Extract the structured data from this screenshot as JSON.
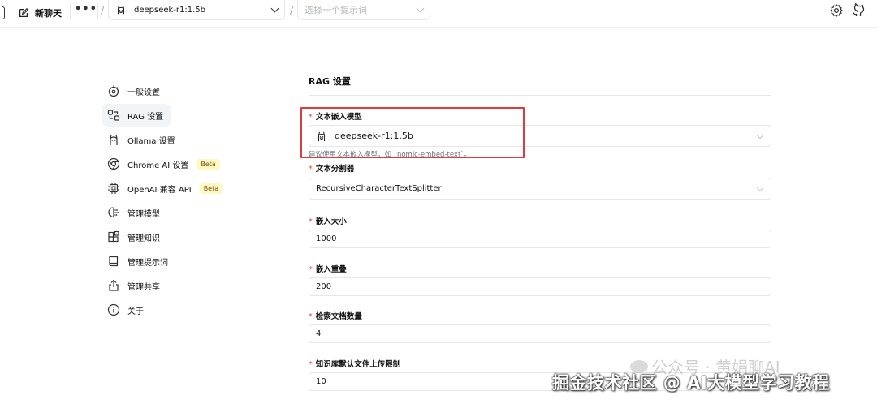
{
  "topbar": {
    "new_chat_label": "新聊天",
    "more_label": "•••",
    "slash1": "/",
    "model_select_value": "deepseek-r1:1.5b",
    "slash2": "/",
    "prompt_select_placeholder": "选择一个提示词",
    "icons": [
      "edit-icon",
      "more-icon",
      "ollama-icon",
      "chevron-down-icon",
      "settings-icon",
      "github-icon"
    ]
  },
  "sidebar": {
    "items": [
      {
        "label": "一般设置",
        "icon": "general-settings-icon",
        "active": false
      },
      {
        "label": "RAG 设置",
        "icon": "rag-icon",
        "active": true
      },
      {
        "label": "Ollama 设置",
        "icon": "ollama-icon",
        "active": false
      },
      {
        "label": "Chrome AI 设置",
        "icon": "chrome-icon",
        "active": false,
        "badge": "Beta"
      },
      {
        "label": "OpenAI 兼容 API",
        "icon": "chip-icon",
        "active": false,
        "badge": "Beta"
      },
      {
        "label": "管理模型",
        "icon": "brain-icon",
        "active": false
      },
      {
        "label": "管理知识",
        "icon": "blocks-icon",
        "active": false
      },
      {
        "label": "管理提示词",
        "icon": "book-icon",
        "active": false
      },
      {
        "label": "管理共享",
        "icon": "share-icon",
        "active": false
      },
      {
        "label": "关于",
        "icon": "info-icon",
        "active": false
      }
    ]
  },
  "main": {
    "title": "RAG 设置",
    "fields": {
      "embedding_model": {
        "label": "文本嵌入模型",
        "value": "deepseek-r1:1.5b",
        "help": "建议使用文本嵌入模型，如 `nomic-embed-text`。"
      },
      "splitter": {
        "label": "文本分割器",
        "value": "RecursiveCharacterTextSplitter"
      },
      "chunk_size": {
        "label": "嵌入大小",
        "value": "1000"
      },
      "chunk_overlap": {
        "label": "嵌入重叠",
        "value": "200"
      },
      "doc_count": {
        "label": "检索文档数量",
        "value": "4"
      },
      "upload_limit": {
        "label": "知识库默认文件上传限制",
        "value": "10"
      }
    },
    "required_mark": "*"
  },
  "watermarks": {
    "wechat": "公众号 · 黄娟聊AI",
    "juejin": "掘金技术社区 @ AI大模型学习教程"
  },
  "colors": {
    "highlight_border": "#e03a3a",
    "required": "#ef4444",
    "beta_bg": "#fef9c3"
  }
}
